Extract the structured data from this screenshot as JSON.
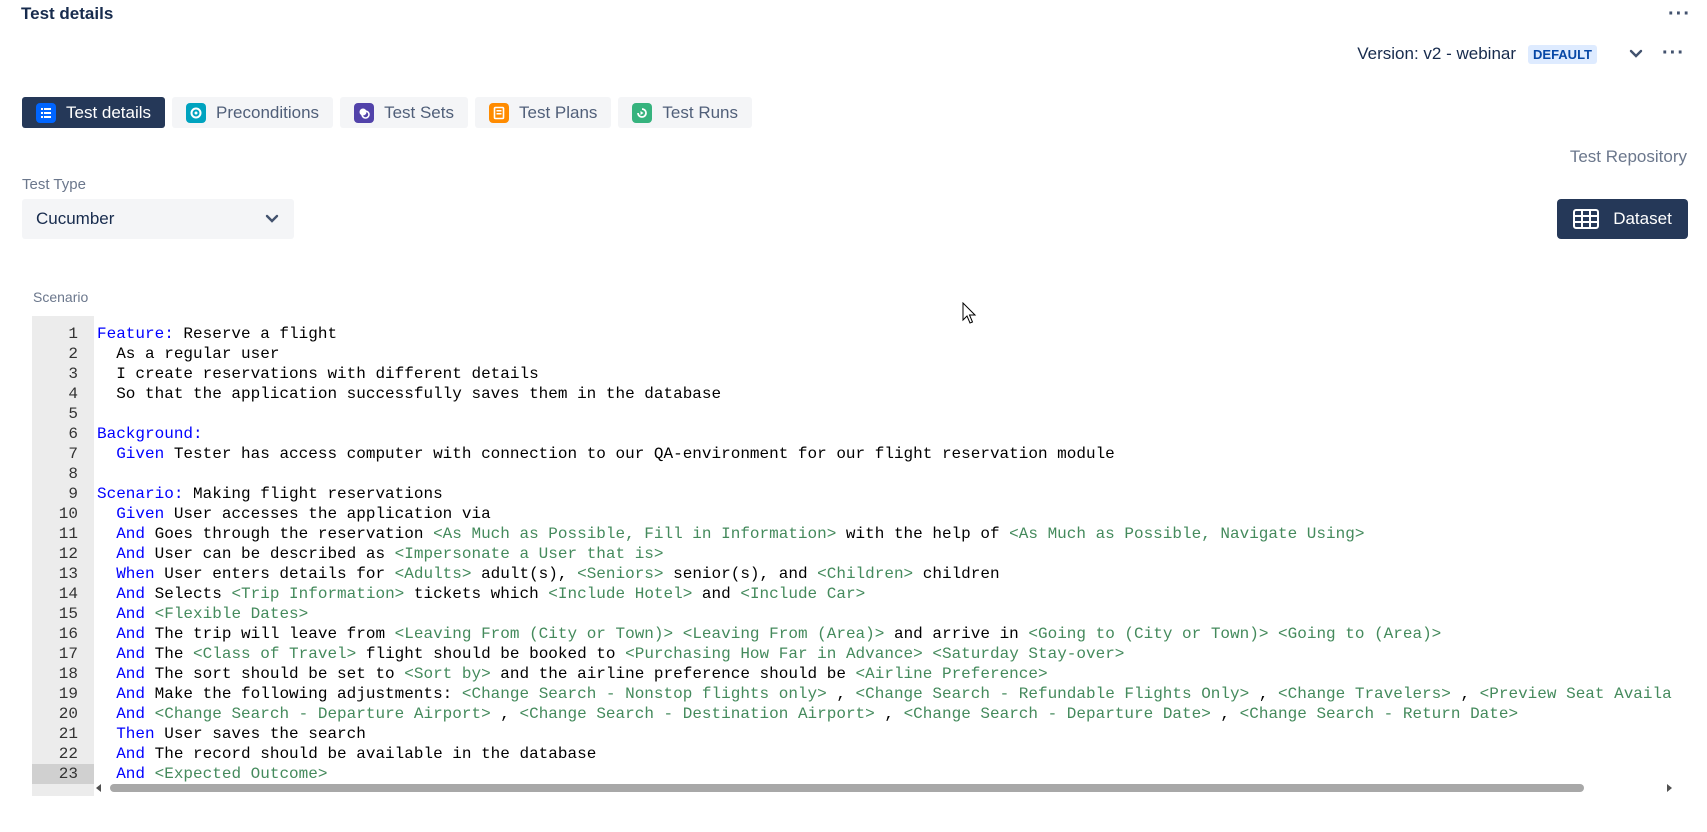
{
  "header": {
    "title": "Test details"
  },
  "version": {
    "label": "Version: v2 - webinar",
    "badge": "DEFAULT"
  },
  "tabs": [
    {
      "label": "Test details",
      "icon": "list-icon",
      "color": "#0065ff"
    },
    {
      "label": "Preconditions",
      "icon": "precondition-icon",
      "color": "#00a3bf"
    },
    {
      "label": "Test Sets",
      "icon": "test-set-icon",
      "color": "#5243aa"
    },
    {
      "label": "Test Plans",
      "icon": "test-plan-icon",
      "color": "#ff8b00"
    },
    {
      "label": "Test Runs",
      "icon": "test-run-icon",
      "color": "#36b37e"
    }
  ],
  "repository_link": "Test Repository",
  "test_type": {
    "label": "Test Type",
    "value": "Cucumber"
  },
  "dataset_button": "Dataset",
  "scenario": {
    "label": "Scenario",
    "active_line": 23,
    "lines": [
      [
        [
          "kw",
          "Feature:"
        ],
        [
          "t",
          " Reserve a flight"
        ]
      ],
      [
        [
          "t",
          "  As a regular user"
        ]
      ],
      [
        [
          "t",
          "  I create reservations with different details"
        ]
      ],
      [
        [
          "t",
          "  So that the application successfully saves them in the database"
        ]
      ],
      [],
      [
        [
          "kw",
          "Background:"
        ]
      ],
      [
        [
          "kw",
          "  Given"
        ],
        [
          "t",
          " Tester has access computer with connection to our QA-environment for our flight reservation module"
        ]
      ],
      [],
      [
        [
          "kw",
          "Scenario:"
        ],
        [
          "t",
          " Making flight reservations"
        ]
      ],
      [
        [
          "kw",
          "  Given"
        ],
        [
          "t",
          " User accesses the application via"
        ]
      ],
      [
        [
          "kw",
          "  And"
        ],
        [
          "t",
          " Goes through the reservation "
        ],
        [
          "ph",
          "<As Much as Possible, Fill in Information>"
        ],
        [
          "t",
          " with the help of "
        ],
        [
          "ph",
          "<As Much as Possible, Navigate Using>"
        ]
      ],
      [
        [
          "kw",
          "  And"
        ],
        [
          "t",
          " User can be described as "
        ],
        [
          "ph",
          "<Impersonate a User that is>"
        ]
      ],
      [
        [
          "kw",
          "  When"
        ],
        [
          "t",
          " User enters details for "
        ],
        [
          "ph",
          "<Adults>"
        ],
        [
          "t",
          " adult(s), "
        ],
        [
          "ph",
          "<Seniors>"
        ],
        [
          "t",
          " senior(s), and "
        ],
        [
          "ph",
          "<Children>"
        ],
        [
          "t",
          " children"
        ]
      ],
      [
        [
          "kw",
          "  And"
        ],
        [
          "t",
          " Selects "
        ],
        [
          "ph",
          "<Trip Information>"
        ],
        [
          "t",
          " tickets which "
        ],
        [
          "ph",
          "<Include Hotel>"
        ],
        [
          "t",
          " and "
        ],
        [
          "ph",
          "<Include Car>"
        ]
      ],
      [
        [
          "kw",
          "  And"
        ],
        [
          "t",
          " "
        ],
        [
          "ph",
          "<Flexible Dates>"
        ]
      ],
      [
        [
          "kw",
          "  And"
        ],
        [
          "t",
          " The trip will leave from "
        ],
        [
          "ph",
          "<Leaving From (City or Town)>"
        ],
        [
          "t",
          " "
        ],
        [
          "ph",
          "<Leaving From (Area)>"
        ],
        [
          "t",
          " and arrive in "
        ],
        [
          "ph",
          "<Going to (City or Town)>"
        ],
        [
          "t",
          " "
        ],
        [
          "ph",
          "<Going to (Area)>"
        ]
      ],
      [
        [
          "kw",
          "  And"
        ],
        [
          "t",
          " The "
        ],
        [
          "ph",
          "<Class of Travel>"
        ],
        [
          "t",
          " flight should be booked to "
        ],
        [
          "ph",
          "<Purchasing How Far in Advance>"
        ],
        [
          "t",
          " "
        ],
        [
          "ph",
          "<Saturday Stay-over>"
        ]
      ],
      [
        [
          "kw",
          "  And"
        ],
        [
          "t",
          " The sort should be set to "
        ],
        [
          "ph",
          "<Sort by>"
        ],
        [
          "t",
          " and the airline preference should be "
        ],
        [
          "ph",
          "<Airline Preference>"
        ]
      ],
      [
        [
          "kw",
          "  And"
        ],
        [
          "t",
          " Make the following adjustments: "
        ],
        [
          "ph",
          "<Change Search - Nonstop flights only>"
        ],
        [
          "t",
          " , "
        ],
        [
          "ph",
          "<Change Search - Refundable Flights Only>"
        ],
        [
          "t",
          " , "
        ],
        [
          "ph",
          "<Change Travelers>"
        ],
        [
          "t",
          " , "
        ],
        [
          "ph",
          "<Preview Seat Availa"
        ]
      ],
      [
        [
          "kw",
          "  And"
        ],
        [
          "t",
          " "
        ],
        [
          "ph",
          "<Change Search - Departure Airport>"
        ],
        [
          "t",
          " , "
        ],
        [
          "ph",
          "<Change Search - Destination Airport>"
        ],
        [
          "t",
          " , "
        ],
        [
          "ph",
          "<Change Search - Departure Date>"
        ],
        [
          "t",
          " , "
        ],
        [
          "ph",
          "<Change Search - Return Date>"
        ]
      ],
      [
        [
          "kw",
          "  Then"
        ],
        [
          "t",
          " User saves the search"
        ]
      ],
      [
        [
          "kw",
          "  And"
        ],
        [
          "t",
          " The record should be available in the database"
        ]
      ],
      [
        [
          "kw",
          "  And"
        ],
        [
          "t",
          " "
        ],
        [
          "ph",
          "<Expected Outcome>"
        ]
      ]
    ]
  }
}
